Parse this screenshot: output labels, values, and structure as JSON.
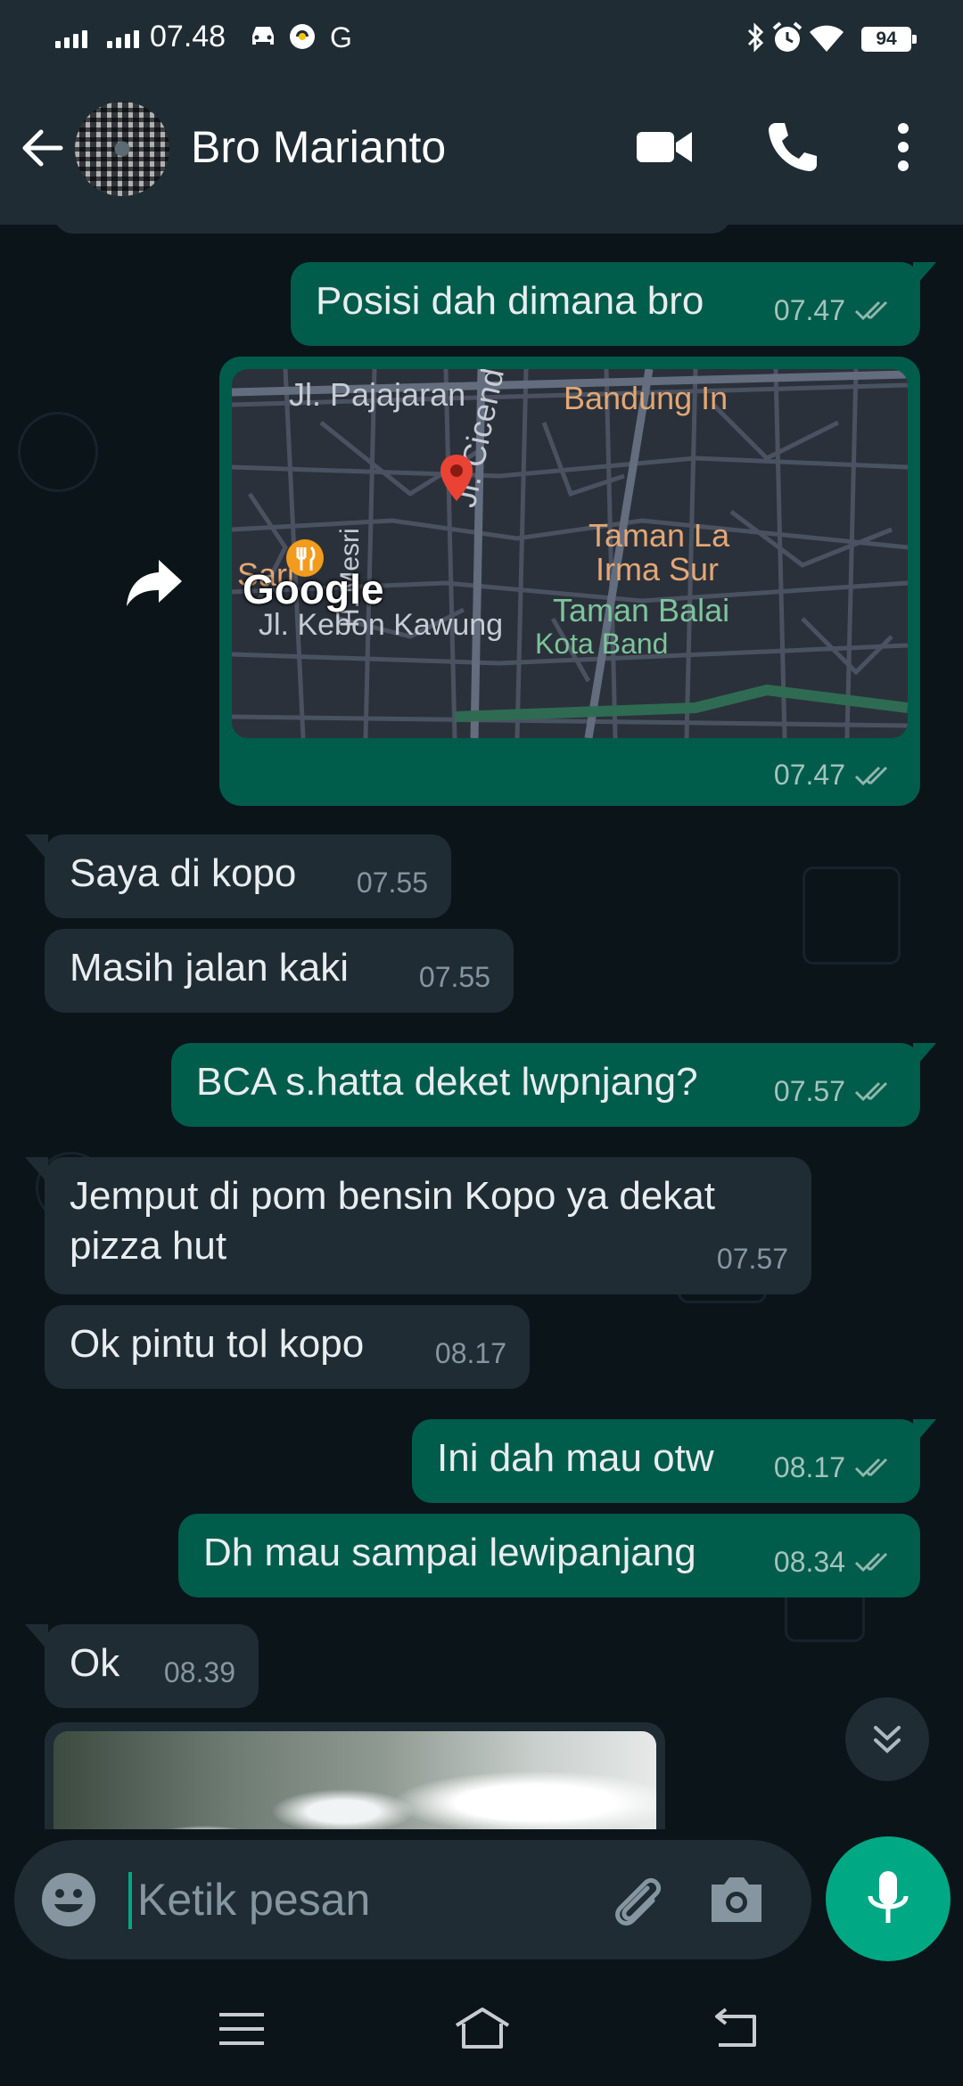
{
  "status_bar": {
    "time": "07.48",
    "battery": "94",
    "g_icon": "G"
  },
  "header": {
    "contact_name": "Bro Marianto"
  },
  "messages": [
    {
      "dir": "out",
      "text": "Posisi dah dimana bro",
      "time": "07.47",
      "ticks": "double"
    },
    {
      "dir": "out",
      "type": "location",
      "time": "07.47",
      "ticks": "double"
    },
    {
      "dir": "in",
      "text": "Saya di kopo",
      "time": "07.55"
    },
    {
      "dir": "in",
      "text": "Masih jalan kaki",
      "time": "07.55"
    },
    {
      "dir": "out",
      "text": "BCA s.hatta deket lwpnjang?",
      "time": "07.57",
      "ticks": "double"
    },
    {
      "dir": "in",
      "text": "Jemput di pom bensin Kopo ya dekat pizza hut",
      "time": "07.57"
    },
    {
      "dir": "in",
      "text": "Ok pintu tol kopo",
      "time": "08.17"
    },
    {
      "dir": "out",
      "text": "Ini dah mau otw",
      "time": "08.17",
      "ticks": "double"
    },
    {
      "dir": "out",
      "text": "Dh mau sampai lewipanjang",
      "time": "08.34",
      "ticks": "double"
    },
    {
      "dir": "in",
      "text": "Ok",
      "time": "08.39"
    },
    {
      "dir": "in",
      "type": "photo"
    }
  ],
  "map": {
    "labels": {
      "pajajaran": "Jl. Pajajaran",
      "bandung": "Bandung In",
      "cicendo": "Jl. Cicendo",
      "mesri": "H. Mesri",
      "taman_l1": "Taman La",
      "taman_l2": "Irma Sur",
      "sari": "Sari",
      "google": "Google",
      "taman_balai": "Taman Balai",
      "kebon": "Jl. Kebon Kawung",
      "kota": "Kota Band"
    }
  },
  "composer": {
    "placeholder": "Ketik pesan"
  },
  "colors": {
    "outgoing": "#005c4b",
    "incoming": "#1f2c34",
    "accent": "#00a884",
    "ticks": "#53bdeb",
    "background": "#0b1418"
  },
  "icons": [
    "back-arrow-icon",
    "video-call-icon",
    "phone-icon",
    "more-vert-icon",
    "forward-icon",
    "map-pin-icon",
    "restaurant-icon",
    "chevron-double-down-icon",
    "emoji-icon",
    "paperclip-icon",
    "camera-icon",
    "mic-icon",
    "menu-icon",
    "home-icon",
    "back-icon"
  ]
}
